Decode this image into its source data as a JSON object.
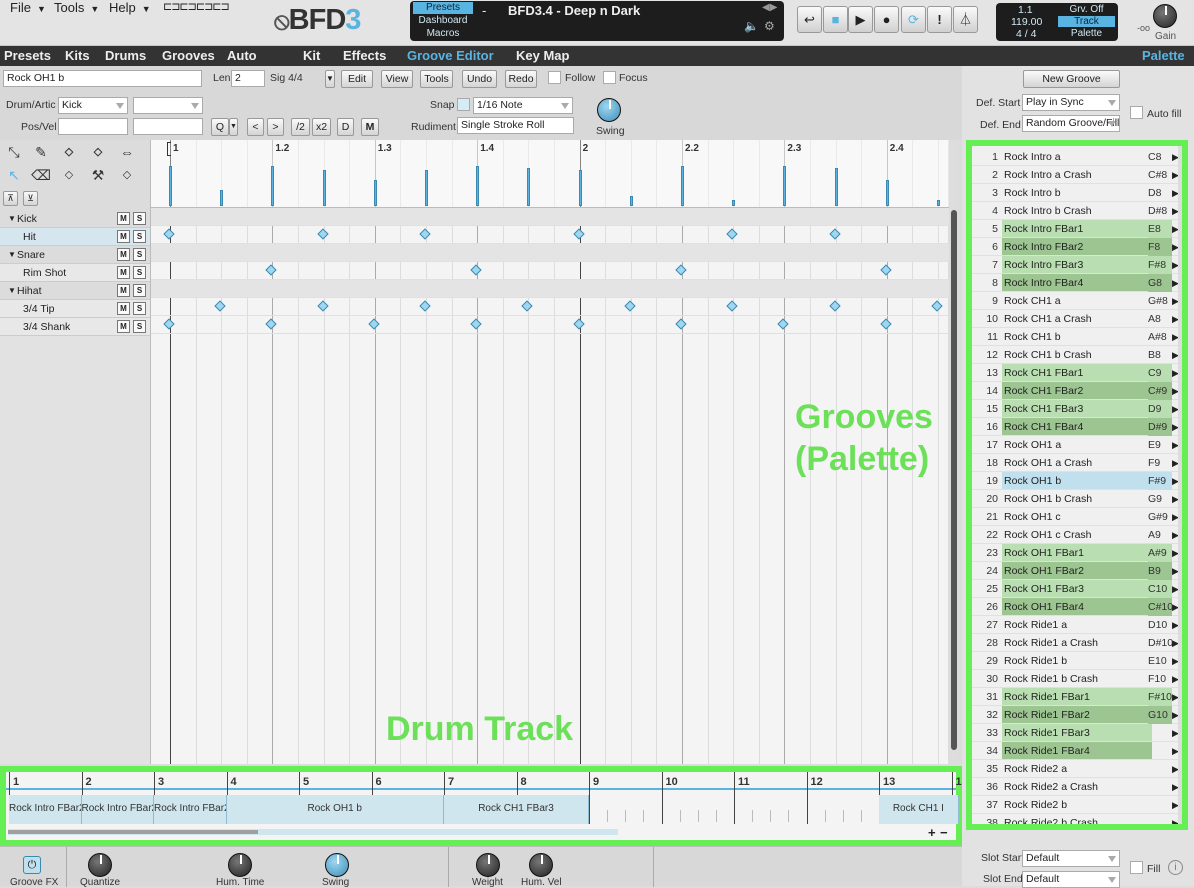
{
  "menus": {
    "file": "File",
    "tools": "Tools",
    "help": "Help"
  },
  "logo": {
    "text": "BFD",
    "digit": "3"
  },
  "preset": {
    "tab_presets": "Presets",
    "tab_dashboard": "Dashboard",
    "tab_macros": "Macros",
    "dash": "-",
    "name": "BFD3.4 - Deep n Dark"
  },
  "transport": {
    "position": "1.1",
    "tempo": "119.00",
    "signature": "4 / 4",
    "groove_mode": "Grv. Off",
    "track": "Track",
    "palette": "Palette"
  },
  "gain": {
    "label": "Gain",
    "min": "-oo"
  },
  "main_menu": [
    "Presets",
    "Kits",
    "Drums",
    "Grooves",
    "Auto",
    "Kit",
    "Effects",
    "Groove Editor",
    "Key Map"
  ],
  "main_menu_active": "Groove Editor",
  "palette_header": "Palette",
  "editor": {
    "groove_name": "Rock OH1 b",
    "len_label": "Len",
    "len_value": "2",
    "sig_label": "Sig 4/4",
    "edit": "Edit",
    "view": "View",
    "tools": "Tools",
    "undo": "Undo",
    "redo": "Redo",
    "follow": "Follow",
    "focus": "Focus",
    "drum_artic_label": "Drum/Artic",
    "drum_value": "Kick",
    "pos_vel_label": "Pos/Vel",
    "q": "Q",
    "lt": "<",
    "gt": ">",
    "half": "/2",
    "double": "x2",
    "d": "D",
    "m": "M",
    "snap_label": "Snap",
    "snap_value": "1/16 Note",
    "rudiment_label": "Rudiment",
    "rudiment_value": "Single Stroke Roll",
    "swing_label": "Swing"
  },
  "tools": {
    "row1": [
      "move-select",
      "pencil",
      "M",
      "H",
      "stretch"
    ],
    "row2": [
      "select",
      "eraser",
      "V",
      "paint",
      "G"
    ]
  },
  "ruler": [
    "1",
    "1.2",
    "1.3",
    "1.4",
    "2",
    "2.2",
    "2.3",
    "2.4"
  ],
  "tracks": [
    {
      "name": "Kick",
      "group": true
    },
    {
      "name": "Hit",
      "group": false,
      "hits": [
        0,
        3,
        5,
        8,
        11,
        13
      ]
    },
    {
      "name": "Snare",
      "group": true
    },
    {
      "name": "Rim Shot",
      "group": false,
      "hits": [
        2,
        6,
        10,
        14
      ]
    },
    {
      "name": "Hihat",
      "group": true
    },
    {
      "name": "3/4 Tip",
      "group": false,
      "hits": [
        1,
        3,
        5,
        7,
        9,
        11,
        13,
        15
      ]
    },
    {
      "name": "3/4 Shank",
      "group": false,
      "hits": [
        0,
        2,
        4,
        6,
        8,
        10,
        12,
        14
      ]
    }
  ],
  "ms": {
    "mute": "M",
    "solo": "S"
  },
  "palette_ctrl": {
    "new_groove": "New Groove",
    "def_start_label": "Def. Start",
    "def_start_value": "Play in Sync",
    "def_end_label": "Def. End",
    "def_end_value": "Random Groove/Fill",
    "auto_fill": "Auto fill",
    "slot_start_label": "Slot Start",
    "slot_start_value": "Default",
    "slot_end_label": "Slot End",
    "slot_end_value": "Default",
    "fill": "Fill"
  },
  "grooves": [
    {
      "n": "1",
      "name": "Rock Intro a",
      "key": "C8",
      "style": ""
    },
    {
      "n": "2",
      "name": "Rock Intro a Crash",
      "key": "C#8",
      "style": ""
    },
    {
      "n": "3",
      "name": "Rock Intro b",
      "key": "D8",
      "style": ""
    },
    {
      "n": "4",
      "name": "Rock Intro b Crash",
      "key": "D#8",
      "style": ""
    },
    {
      "n": "5",
      "name": "Rock Intro FBar1",
      "key": "E8",
      "style": "light"
    },
    {
      "n": "6",
      "name": "Rock Intro FBar2",
      "key": "F8",
      "style": "dark"
    },
    {
      "n": "7",
      "name": "Rock Intro FBar3",
      "key": "F#8",
      "style": "light"
    },
    {
      "n": "8",
      "name": "Rock Intro FBar4",
      "key": "G8",
      "style": "dark"
    },
    {
      "n": "9",
      "name": "Rock CH1 a",
      "key": "G#8",
      "style": ""
    },
    {
      "n": "10",
      "name": "Rock CH1 a Crash",
      "key": "A8",
      "style": ""
    },
    {
      "n": "11",
      "name": "Rock CH1 b",
      "key": "A#8",
      "style": ""
    },
    {
      "n": "12",
      "name": "Rock CH1 b Crash",
      "key": "B8",
      "style": ""
    },
    {
      "n": "13",
      "name": "Rock CH1 FBar1",
      "key": "C9",
      "style": "light"
    },
    {
      "n": "14",
      "name": "Rock CH1 FBar2",
      "key": "C#9",
      "style": "dark"
    },
    {
      "n": "15",
      "name": "Rock CH1 FBar3",
      "key": "D9",
      "style": "light"
    },
    {
      "n": "16",
      "name": "Rock CH1 FBar4",
      "key": "D#9",
      "style": "dark"
    },
    {
      "n": "17",
      "name": "Rock OH1 a",
      "key": "E9",
      "style": ""
    },
    {
      "n": "18",
      "name": "Rock OH1 a Crash",
      "key": "F9",
      "style": ""
    },
    {
      "n": "19",
      "name": "Rock OH1 b",
      "key": "F#9",
      "style": "sel"
    },
    {
      "n": "20",
      "name": "Rock OH1 b Crash",
      "key": "G9",
      "style": ""
    },
    {
      "n": "21",
      "name": "Rock OH1 c",
      "key": "G#9",
      "style": ""
    },
    {
      "n": "22",
      "name": "Rock OH1 c Crash",
      "key": "A9",
      "style": ""
    },
    {
      "n": "23",
      "name": "Rock OH1 FBar1",
      "key": "A#9",
      "style": "light"
    },
    {
      "n": "24",
      "name": "Rock OH1 FBar2",
      "key": "B9",
      "style": "dark"
    },
    {
      "n": "25",
      "name": "Rock OH1 FBar3",
      "key": "C10",
      "style": "light"
    },
    {
      "n": "26",
      "name": "Rock OH1 FBar4",
      "key": "C#10",
      "style": "dark"
    },
    {
      "n": "27",
      "name": "Rock Ride1 a",
      "key": "D10",
      "style": ""
    },
    {
      "n": "28",
      "name": "Rock Ride1 a Crash",
      "key": "D#10",
      "style": ""
    },
    {
      "n": "29",
      "name": "Rock Ride1 b",
      "key": "E10",
      "style": ""
    },
    {
      "n": "30",
      "name": "Rock Ride1 b Crash",
      "key": "F10",
      "style": ""
    },
    {
      "n": "31",
      "name": "Rock Ride1 FBar1",
      "key": "F#10",
      "style": "light"
    },
    {
      "n": "32",
      "name": "Rock Ride1 FBar2",
      "key": "G10",
      "style": "dark"
    },
    {
      "n": "33",
      "name": "Rock Ride1 FBar3",
      "key": "",
      "style": "light"
    },
    {
      "n": "34",
      "name": "Rock Ride1 FBar4",
      "key": "",
      "style": "dark"
    },
    {
      "n": "35",
      "name": "Rock Ride2 a",
      "key": "",
      "style": ""
    },
    {
      "n": "36",
      "name": "Rock Ride2 a Crash",
      "key": "",
      "style": ""
    },
    {
      "n": "37",
      "name": "Rock Ride2 b",
      "key": "",
      "style": ""
    },
    {
      "n": "38",
      "name": "Rock Ride2 b Crash",
      "key": "",
      "style": ""
    }
  ],
  "drum_track": {
    "bars": [
      "1",
      "2",
      "3",
      "4",
      "5",
      "6",
      "7",
      "8",
      "9",
      "10",
      "11",
      "12",
      "13",
      "1"
    ],
    "segments": [
      {
        "label": "Rock Intro FBar2",
        "bars": [
          1,
          2
        ]
      },
      {
        "label": "Rock Intro FBar2",
        "bars": [
          2,
          3
        ]
      },
      {
        "label": "Rock Intro FBar2",
        "bars": [
          3,
          4
        ]
      },
      {
        "label": "Rock OH1 b",
        "bars": [
          4,
          7
        ]
      },
      {
        "label": "Rock CH1 FBar3",
        "bars": [
          7,
          9
        ]
      },
      {
        "label": "Rock CH1 I",
        "bars": [
          13,
          14.1
        ]
      }
    ]
  },
  "annotations": {
    "grooves": "Grooves\n(Palette)",
    "drum_track": "Drum Track"
  },
  "bottom": {
    "groove_fx": "Groove FX",
    "quantize": "Quantize",
    "hum_time": "Hum. Time",
    "swing": "Swing",
    "weight": "Weight",
    "hum_vel": "Hum. Vel"
  }
}
